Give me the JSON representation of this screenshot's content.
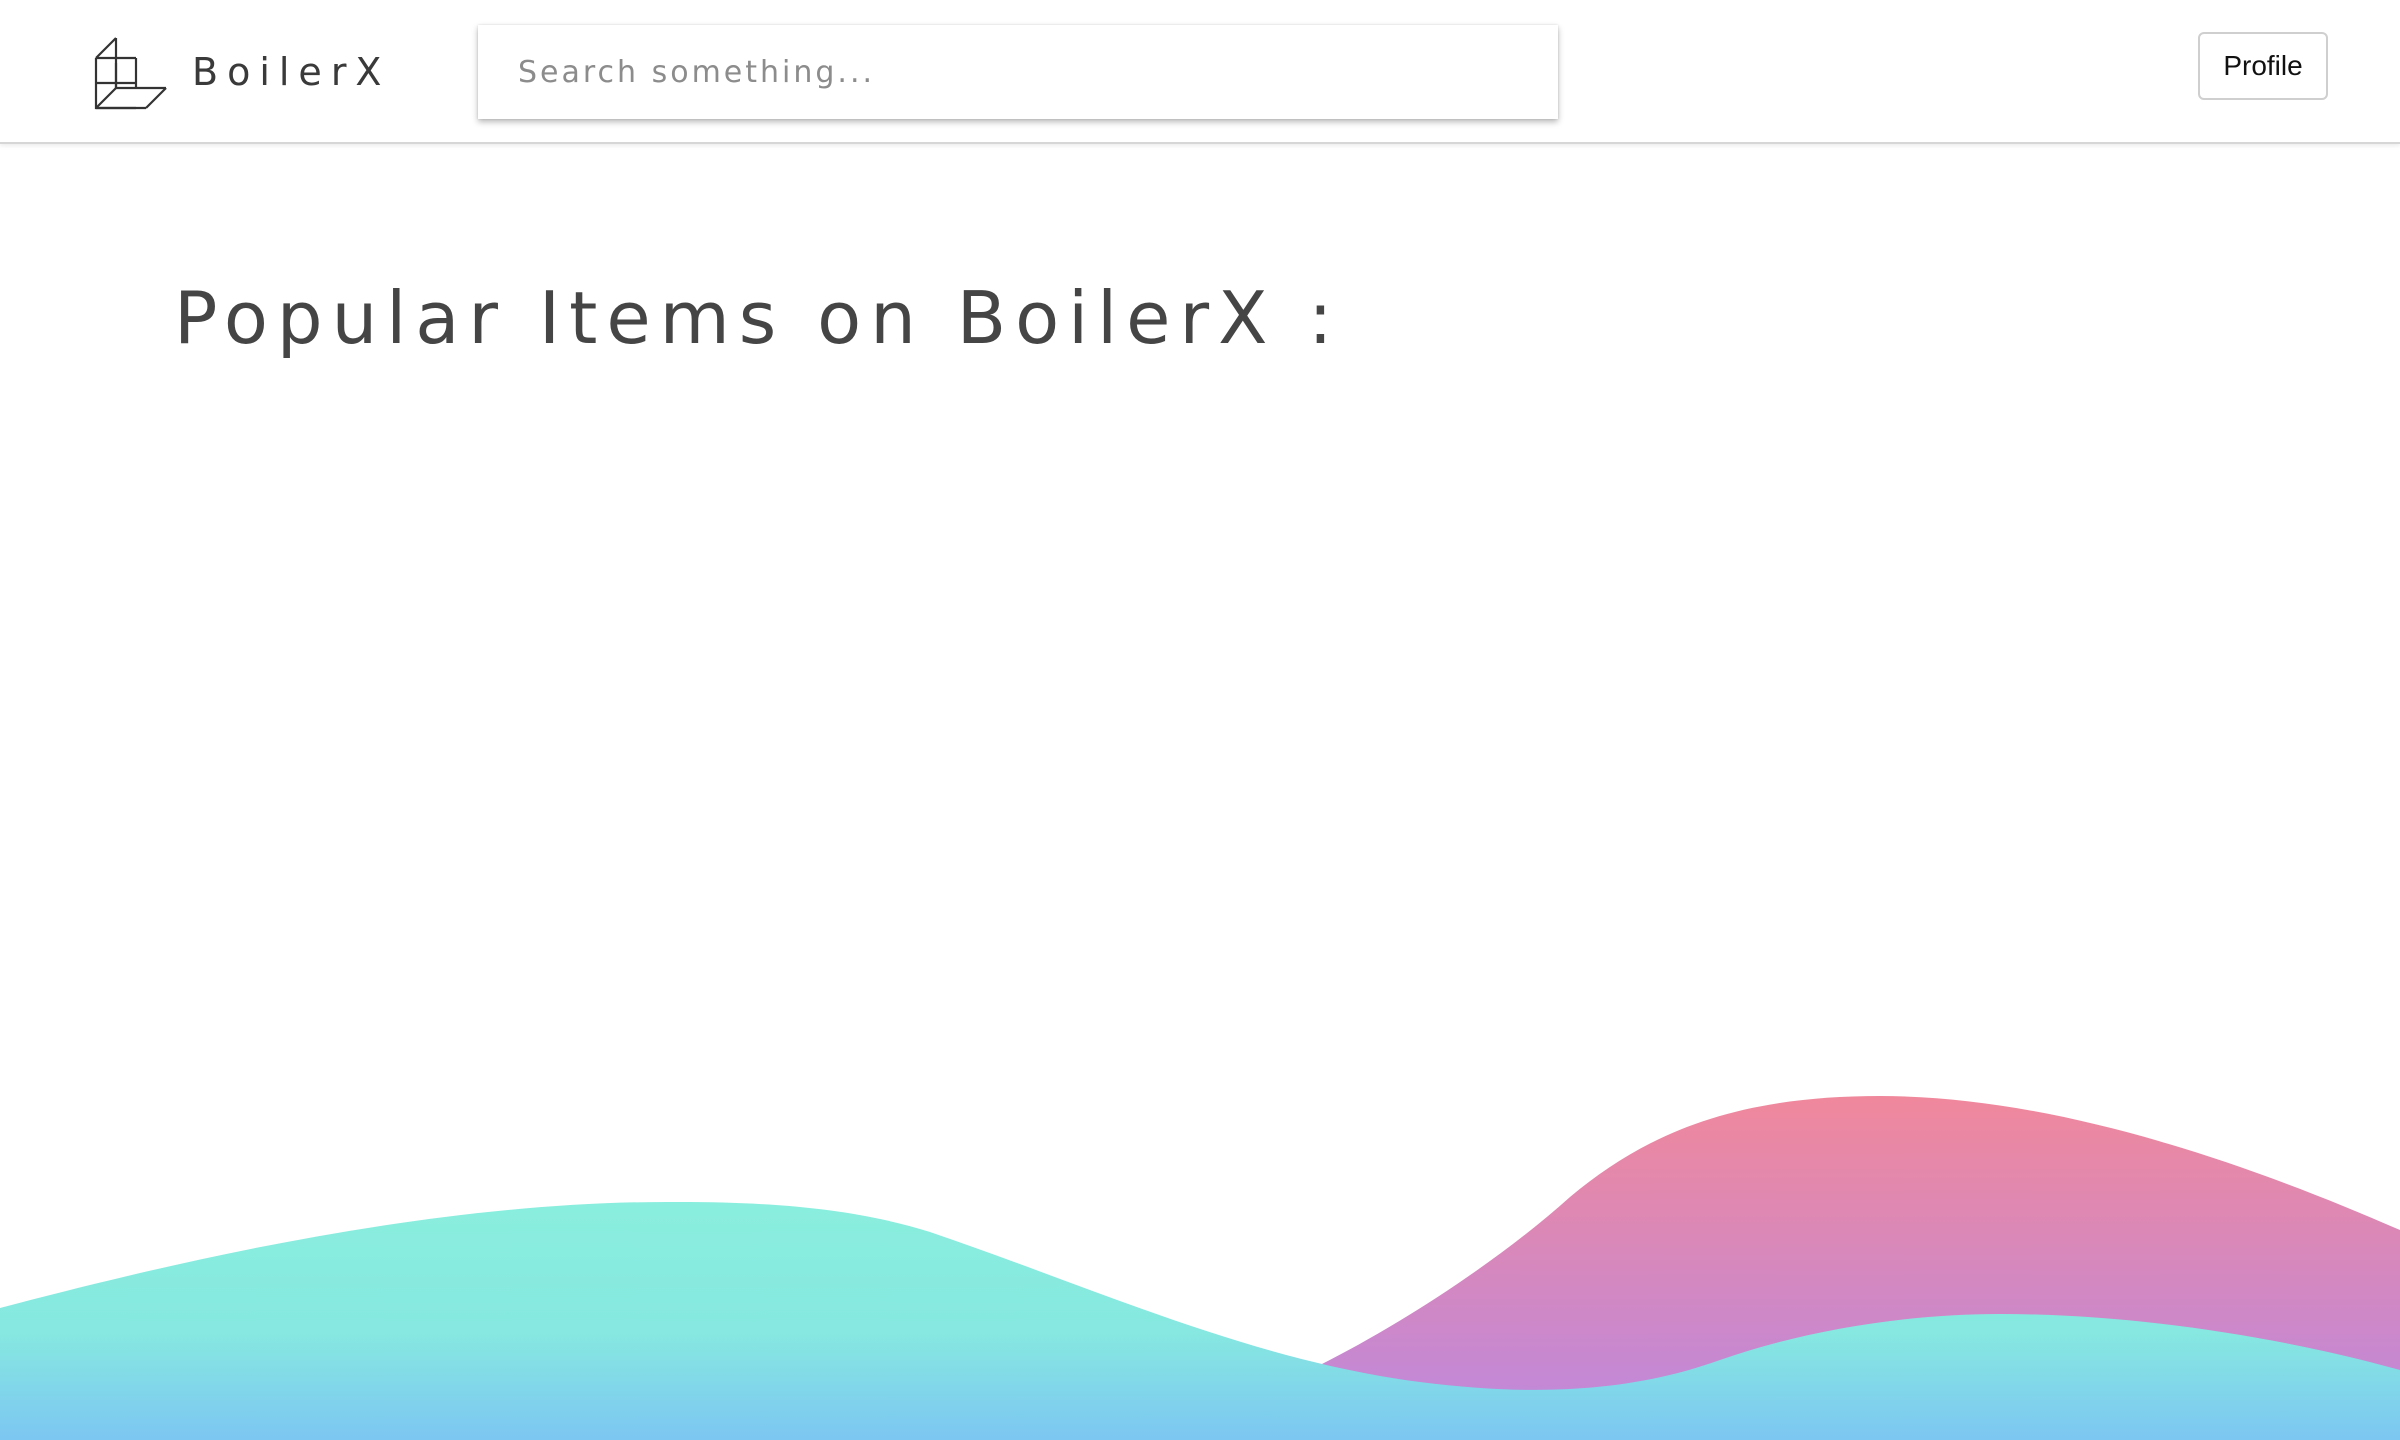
{
  "header": {
    "brand_name": "BoilerX",
    "brand_logo_icon": "cube-outline-icon",
    "search": {
      "placeholder": "Search something...",
      "value": ""
    },
    "profile_label": "Profile"
  },
  "main": {
    "title": "Popular Items on BoilerX :"
  },
  "decoration": {
    "wave_back_colors": [
      "#f0889c",
      "#bb88e0"
    ],
    "wave_front_colors": [
      "#8aeede",
      "#86dde4",
      "#7cc6f2"
    ]
  }
}
